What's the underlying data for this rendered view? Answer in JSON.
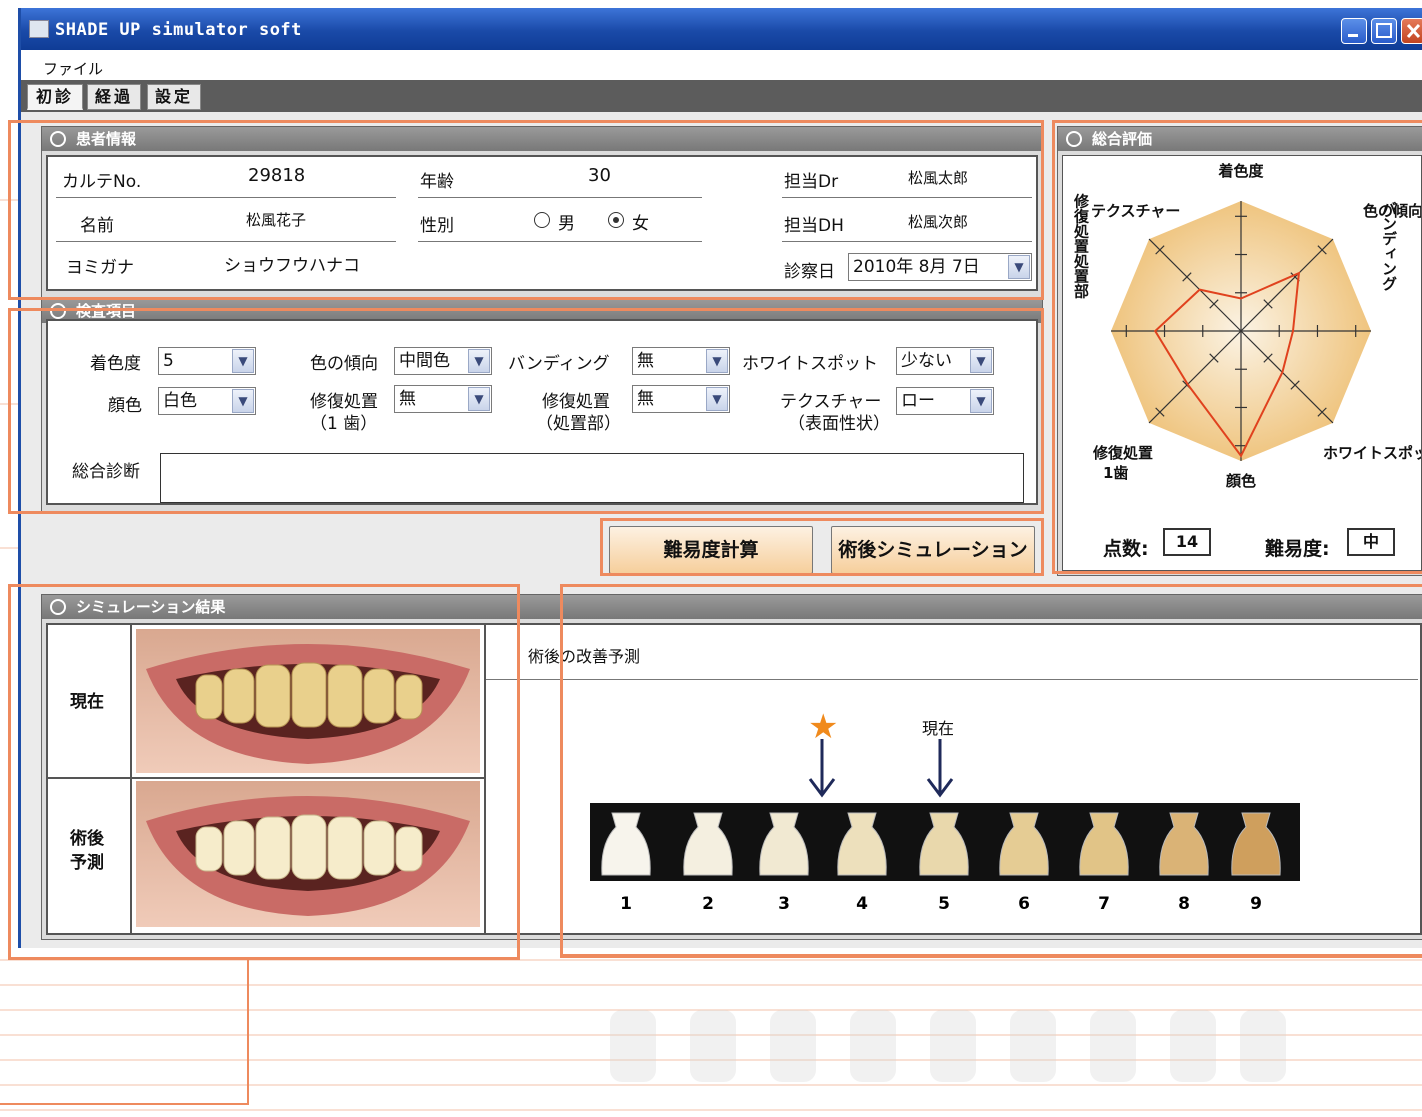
{
  "window": {
    "title": "SHADE UP simulator soft"
  },
  "menu": {
    "file": "ファイル"
  },
  "tabs": [
    {
      "label": "初診",
      "selected": true
    },
    {
      "label": "経過",
      "selected": false
    },
    {
      "label": "設定",
      "selected": false
    }
  ],
  "patient": {
    "header": "患者情報",
    "karte_label": "カルテNo.",
    "karte": "29818",
    "age_label": "年齢",
    "age": "30",
    "dr_label": "担当Dr",
    "dr": "松風太郎",
    "name_label": "名前",
    "name": "松風花子",
    "sex_label": "性別",
    "sex_male": "男",
    "sex_female": "女",
    "sex_selected": "女",
    "dh_label": "担当DH",
    "dh": "松風次郎",
    "kana_label": "ヨミガナ",
    "kana": "ショウフウハナコ",
    "date_label": "診察日",
    "date": "2010年  8月  7日"
  },
  "exam": {
    "header": "検査項目",
    "chaku_label": "着色度",
    "chaku": "5",
    "iro_label": "色の傾向",
    "iro": "中間色",
    "band_label": "バンディング",
    "band": "無",
    "white_label": "ホワイトスポット",
    "white": "少ない",
    "gan_label": "顔色",
    "gan": "白色",
    "rep1_label": "修復処置",
    "rep1_sub": "（1 歯）",
    "rep1": "無",
    "rep2_label": "修復処置",
    "rep2_sub": "（処置部）",
    "rep2": "無",
    "tex_label": "テクスチャー",
    "tex_sub": "（表面性状）",
    "tex": "ロー",
    "sogo_label": "総合診断",
    "sogo": ""
  },
  "buttons": {
    "calc": "難易度計算",
    "sim": "術後シミュレーション"
  },
  "eval": {
    "header": "総合評価",
    "axes": [
      "着色度",
      "色の傾向",
      "バンディング",
      "ホワイトスポット",
      "顔色",
      "修復処置 1歯",
      "修復処置 処置部",
      "テクスチャー"
    ],
    "values": [
      0.25,
      0.63,
      0.4,
      0.45,
      0.96,
      0.58,
      0.66,
      0.45
    ],
    "score_label": "点数:",
    "score": "14",
    "diff_label": "難易度:",
    "diff": "中"
  },
  "sim": {
    "header": "シミュレーション結果",
    "now": "現在",
    "after": "術後予測",
    "forecast": "術後の改善予測",
    "now_marker": "現在",
    "target_marker": "★",
    "shades": [
      "1",
      "2",
      "3",
      "4",
      "5",
      "6",
      "7",
      "8",
      "9"
    ],
    "current_shade": 5,
    "target_shade": 4
  },
  "colors": {
    "accent": "#ee8a5e",
    "titlebar": "#1a4aa8"
  }
}
